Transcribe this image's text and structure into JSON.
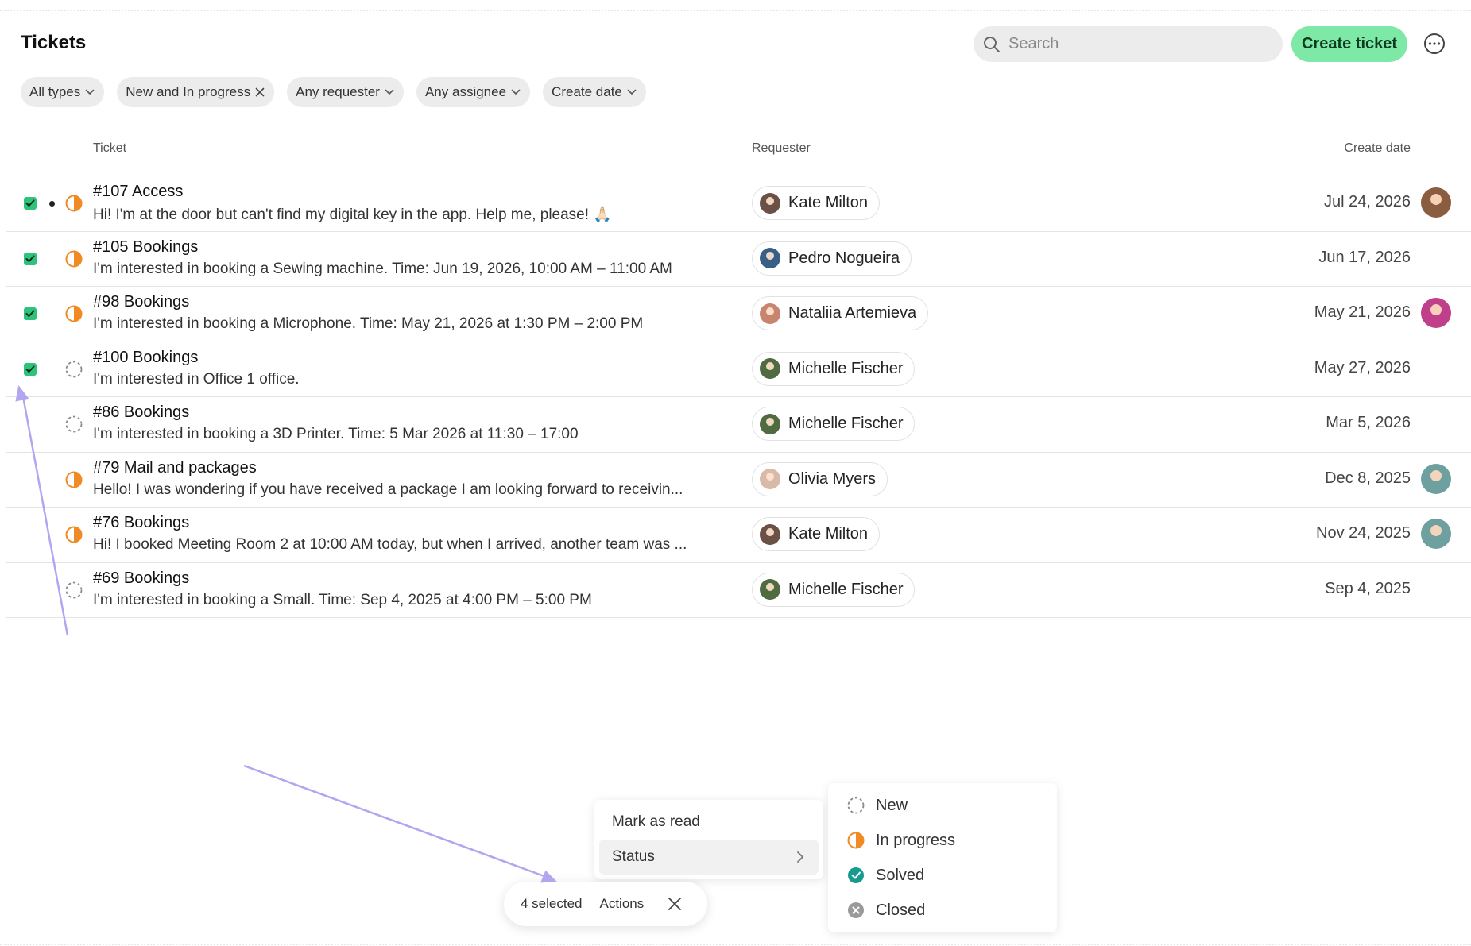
{
  "header": {
    "title": "Tickets",
    "search_placeholder": "Search",
    "create_label": "Create ticket"
  },
  "filters": [
    {
      "label": "All types",
      "icon": "chevron-down-icon"
    },
    {
      "label": "New and In progress",
      "icon": "close-icon"
    },
    {
      "label": "Any requester",
      "icon": "chevron-down-icon"
    },
    {
      "label": "Any assignee",
      "icon": "chevron-down-icon"
    },
    {
      "label": "Create date",
      "icon": "chevron-down-icon"
    }
  ],
  "table": {
    "columns": {
      "ticket": "Ticket",
      "requester": "Requester",
      "date": "Create date"
    },
    "rows": [
      {
        "title": "#107 Access",
        "desc": "Hi! I'm at the door but can't find my digital key in the app. Help me, please! 🙏🏻",
        "requester": "Kate Milton",
        "date": "Jul 24, 2026",
        "status": "in-progress",
        "checked": true,
        "unread": true,
        "assignee": true
      },
      {
        "title": "#105 Bookings",
        "desc": "I'm interested in booking a Sewing machine. Time: Jun 19, 2026, 10:00 AM – 11:00 AM",
        "requester": "Pedro Nogueira",
        "date": "Jun 17, 2026",
        "status": "in-progress",
        "checked": true,
        "unread": false,
        "assignee": false
      },
      {
        "title": "#98 Bookings",
        "desc": "I'm interested in booking a Microphone. Time: May 21, 2026 at 1:30 PM – 2:00 PM",
        "requester": "Nataliia Artemieva",
        "date": "May 21, 2026",
        "status": "in-progress",
        "checked": true,
        "unread": false,
        "assignee": true
      },
      {
        "title": "#100 Bookings",
        "desc": "I'm interested in Office 1 office.",
        "requester": "Michelle Fischer",
        "date": "May 27, 2026",
        "status": "new",
        "checked": true,
        "unread": false,
        "assignee": false
      },
      {
        "title": "#86 Bookings",
        "desc": "I'm interested in booking a 3D Printer. Time: 5 Mar 2026 at 11:30 – 17:00",
        "requester": "Michelle Fischer",
        "date": "Mar 5, 2026",
        "status": "new",
        "checked": false,
        "unread": false,
        "assignee": false
      },
      {
        "title": "#79 Mail and packages",
        "desc": "Hello! I was wondering if you have received a package I am looking forward to receivin...",
        "requester": "Olivia Myers",
        "date": "Dec 8, 2025",
        "status": "in-progress",
        "checked": false,
        "unread": false,
        "assignee": true
      },
      {
        "title": "#76 Bookings",
        "desc": "Hi! I booked Meeting Room 2 at 10:00 AM today, but when I arrived, another team was ...",
        "requester": "Kate Milton",
        "date": "Nov 24, 2025",
        "status": "in-progress",
        "checked": false,
        "unread": false,
        "assignee": true
      },
      {
        "title": "#69 Bookings",
        "desc": "I'm interested in booking a Small. Time: Sep 4, 2025 at 4:00 PM – 5:00 PM",
        "requester": "Michelle Fischer",
        "date": "Sep 4, 2025",
        "status": "new",
        "checked": false,
        "unread": false,
        "assignee": false
      }
    ]
  },
  "selection_bar": {
    "count_label": "4 selected",
    "actions_label": "Actions"
  },
  "actions_menu": {
    "items": [
      "Mark as read",
      "Status"
    ]
  },
  "status_menu": {
    "items": [
      {
        "label": "New",
        "status": "new"
      },
      {
        "label": "In progress",
        "status": "in-progress"
      },
      {
        "label": "Solved",
        "status": "solved"
      },
      {
        "label": "Closed",
        "status": "closed"
      }
    ]
  },
  "colors": {
    "accent_green": "#7ee8a6",
    "checkbox_green": "#2ec27a",
    "in_progress_orange": "#f08a24",
    "solved_teal": "#179b8e",
    "closed_gray": "#9a9a9a",
    "annotation_purple": "#b3a6f0"
  }
}
